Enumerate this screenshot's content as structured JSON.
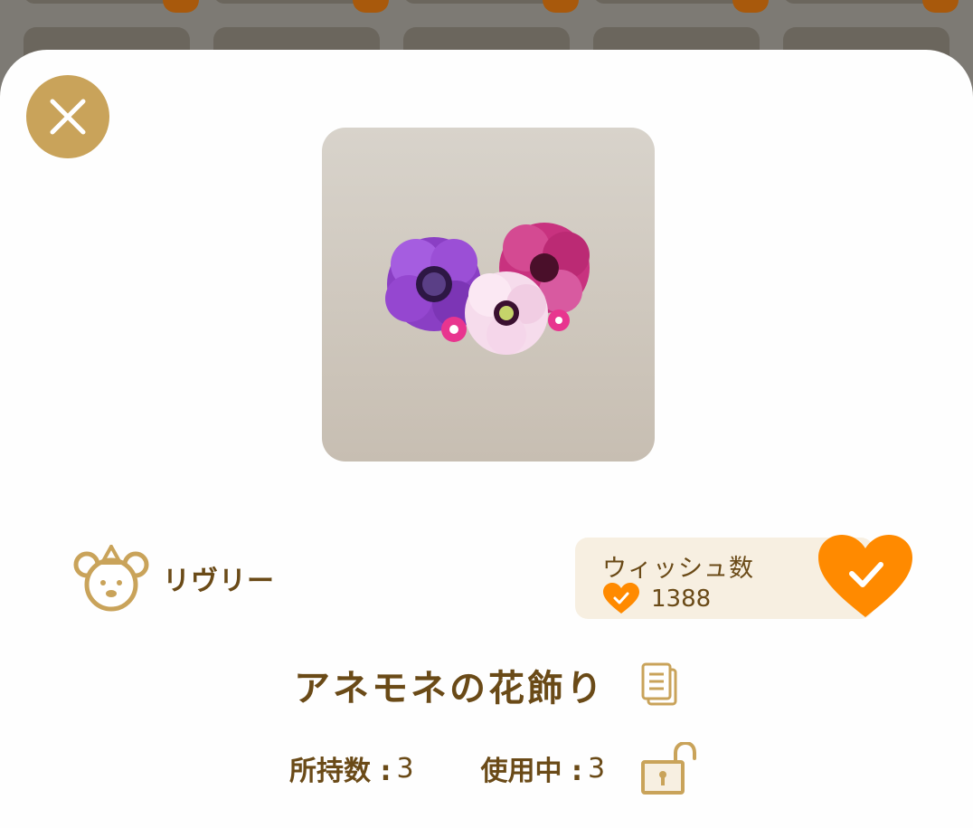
{
  "modal": {
    "brand_name": "リヴリー",
    "wish": {
      "label": "ウィッシュ数",
      "count": "1388",
      "wished": true
    },
    "item_title": "アネモネの花飾り",
    "owned_label": "所持数 :",
    "owned_value": "3",
    "in_use_label": "使用中 :",
    "in_use_value": "3"
  },
  "colors": {
    "accent_gold": "#c9a35a",
    "wish_orange": "#ff8a00",
    "text_brown": "#6a4a17"
  },
  "icons": [
    "close-icon",
    "bear-logo-icon",
    "heart-icon",
    "heart-check-icon",
    "copy-icon",
    "unlock-icon"
  ]
}
